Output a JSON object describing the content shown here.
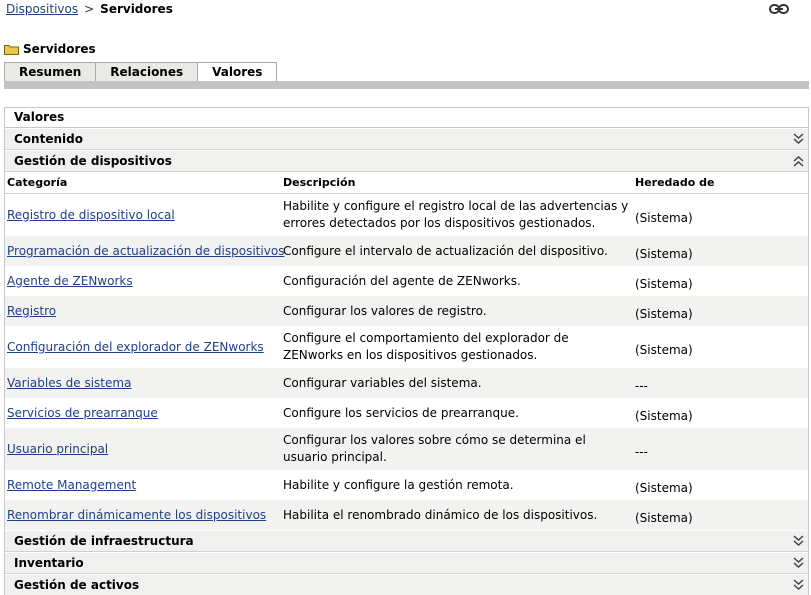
{
  "breadcrumb": {
    "root": "Dispositivos",
    "separator": ">",
    "current": "Servidores"
  },
  "page": {
    "title": "Servidores"
  },
  "tabs": [
    {
      "label": "Resumen"
    },
    {
      "label": "Relaciones"
    },
    {
      "label": "Valores",
      "active": true
    }
  ],
  "panel": {
    "title": "Valores",
    "sections_top": [
      {
        "label": "Contenido",
        "state": "collapsed"
      },
      {
        "label": "Gestión de dispositivos",
        "state": "expanded"
      }
    ],
    "columns": {
      "category": "Categoría",
      "description": "Descripción",
      "inherited": "Heredado de"
    },
    "rows": [
      {
        "category": "Registro de dispositivo local",
        "description": "Habilite y configure el registro local de las advertencias y errores detectados por los dispositivos gestionados.",
        "inherited": "(Sistema)"
      },
      {
        "category": "Programación de actualización de dispositivos",
        "description": "Configure el intervalo de actualización del dispositivo.",
        "inherited": "(Sistema)"
      },
      {
        "category": "Agente de ZENworks",
        "description": "Configuración del agente de ZENworks.",
        "inherited": "(Sistema)"
      },
      {
        "category": "Registro",
        "description": "Configurar los valores de registro.",
        "inherited": "(Sistema)"
      },
      {
        "category": "Configuración del explorador de ZENworks",
        "description": "Configure el comportamiento del explorador de ZENworks en los dispositivos gestionados.",
        "inherited": "(Sistema)"
      },
      {
        "category": "Variables de sistema",
        "description": "Configurar variables del sistema.",
        "inherited": "---"
      },
      {
        "category": "Servicios de prearranque",
        "description": "Configure los servicios de prearranque.",
        "inherited": "(Sistema)"
      },
      {
        "category": "Usuario principal",
        "description": "Configurar los valores sobre cómo se determina el usuario principal.",
        "inherited": "---"
      },
      {
        "category": "Remote Management",
        "description": "Habilite y configure la gestión remota.",
        "inherited": "(Sistema)"
      },
      {
        "category": "Renombrar dinámicamente los dispositivos",
        "description": "Habilita el renombrado dinámico de los dispositivos.",
        "inherited": "(Sistema)"
      }
    ],
    "sections_bottom": [
      {
        "label": "Gestión de infraestructura",
        "state": "collapsed"
      },
      {
        "label": "Inventario",
        "state": "collapsed"
      },
      {
        "label": "Gestión de activos",
        "state": "collapsed"
      }
    ]
  },
  "colors": {
    "link": "#1f3f8a",
    "tab_bar": "#c3c3c3",
    "section_bg": "#f0f0ee",
    "row_alt": "#f2f2f0",
    "folder": "#e8c84a"
  },
  "icons": {
    "link": "link-icon",
    "folder": "folder-icon",
    "collapse": "double-chevron-down-icon",
    "expand": "double-chevron-up-icon"
  }
}
